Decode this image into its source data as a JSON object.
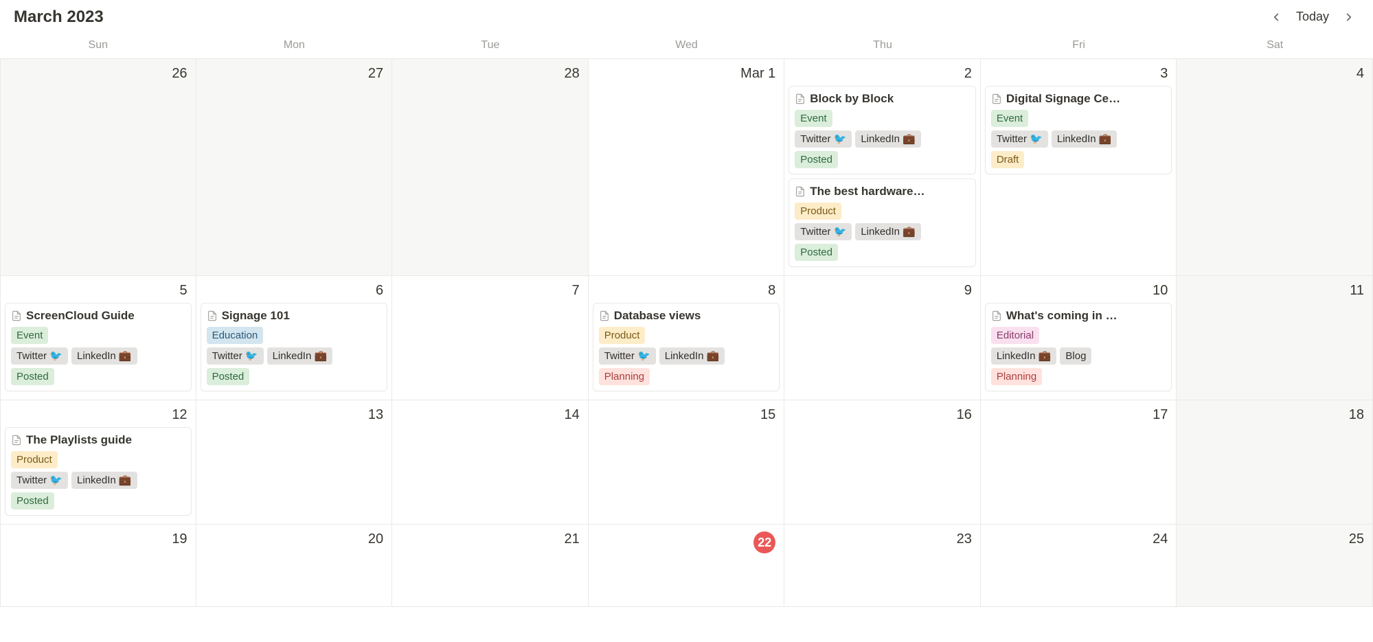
{
  "header": {
    "title": "March 2023",
    "today_label": "Today"
  },
  "days_of_week": [
    "Sun",
    "Mon",
    "Tue",
    "Wed",
    "Thu",
    "Fri",
    "Sat"
  ],
  "tag_colors": {
    "Event": "green",
    "Product": "yellow",
    "Education": "blue",
    "Editorial": "pink",
    "Twitter 🐦": "gray",
    "LinkedIn 💼": "gray",
    "Blog": "gray",
    "Posted": "green",
    "Draft": "yellow",
    "Planning": "red"
  },
  "weeks": [
    [
      {
        "label": "26",
        "outside": true,
        "events": []
      },
      {
        "label": "27",
        "outside": true,
        "events": []
      },
      {
        "label": "28",
        "outside": true,
        "events": []
      },
      {
        "label": "Mar 1",
        "outside": false,
        "events": []
      },
      {
        "label": "2",
        "outside": false,
        "events": [
          {
            "title": "Block by Block",
            "rows": [
              [
                "Event"
              ],
              [
                "Twitter 🐦",
                "LinkedIn 💼"
              ],
              [
                "Posted"
              ]
            ]
          },
          {
            "title": "The best hardware…",
            "rows": [
              [
                "Product"
              ],
              [
                "Twitter 🐦",
                "LinkedIn 💼"
              ],
              [
                "Posted"
              ]
            ]
          }
        ]
      },
      {
        "label": "3",
        "outside": false,
        "events": [
          {
            "title": "Digital Signage Ce…",
            "rows": [
              [
                "Event"
              ],
              [
                "Twitter 🐦",
                "LinkedIn 💼"
              ],
              [
                "Draft"
              ]
            ]
          }
        ]
      },
      {
        "label": "4",
        "outside": true,
        "events": []
      }
    ],
    [
      {
        "label": "5",
        "outside": false,
        "events": [
          {
            "title": "ScreenCloud Guide",
            "rows": [
              [
                "Event"
              ],
              [
                "Twitter 🐦",
                "LinkedIn 💼"
              ],
              [
                "Posted"
              ]
            ]
          }
        ]
      },
      {
        "label": "6",
        "outside": false,
        "events": [
          {
            "title": "Signage 101",
            "rows": [
              [
                "Education"
              ],
              [
                "Twitter 🐦",
                "LinkedIn 💼"
              ],
              [
                "Posted"
              ]
            ]
          }
        ]
      },
      {
        "label": "7",
        "outside": false,
        "events": []
      },
      {
        "label": "8",
        "outside": false,
        "events": [
          {
            "title": "Database views",
            "rows": [
              [
                "Product"
              ],
              [
                "Twitter 🐦",
                "LinkedIn 💼"
              ],
              [
                "Planning"
              ]
            ]
          }
        ]
      },
      {
        "label": "9",
        "outside": false,
        "events": []
      },
      {
        "label": "10",
        "outside": false,
        "events": [
          {
            "title": "What's coming in …",
            "rows": [
              [
                "Editorial"
              ],
              [
                "LinkedIn 💼",
                "Blog"
              ],
              [
                "Planning"
              ]
            ]
          }
        ]
      },
      {
        "label": "11",
        "outside": true,
        "events": []
      }
    ],
    [
      {
        "label": "12",
        "outside": false,
        "events": [
          {
            "title": "The Playlists guide",
            "rows": [
              [
                "Product"
              ],
              [
                "Twitter 🐦",
                "LinkedIn 💼"
              ],
              [
                "Posted"
              ]
            ]
          }
        ]
      },
      {
        "label": "13",
        "outside": false,
        "events": []
      },
      {
        "label": "14",
        "outside": false,
        "events": []
      },
      {
        "label": "15",
        "outside": false,
        "events": []
      },
      {
        "label": "16",
        "outside": false,
        "events": []
      },
      {
        "label": "17",
        "outside": false,
        "events": []
      },
      {
        "label": "18",
        "outside": true,
        "events": []
      }
    ],
    [
      {
        "label": "19",
        "outside": false,
        "events": []
      },
      {
        "label": "20",
        "outside": false,
        "events": []
      },
      {
        "label": "21",
        "outside": false,
        "events": []
      },
      {
        "label": "22",
        "outside": false,
        "today": true,
        "events": []
      },
      {
        "label": "23",
        "outside": false,
        "events": []
      },
      {
        "label": "24",
        "outside": false,
        "events": []
      },
      {
        "label": "25",
        "outside": true,
        "events": []
      }
    ]
  ]
}
